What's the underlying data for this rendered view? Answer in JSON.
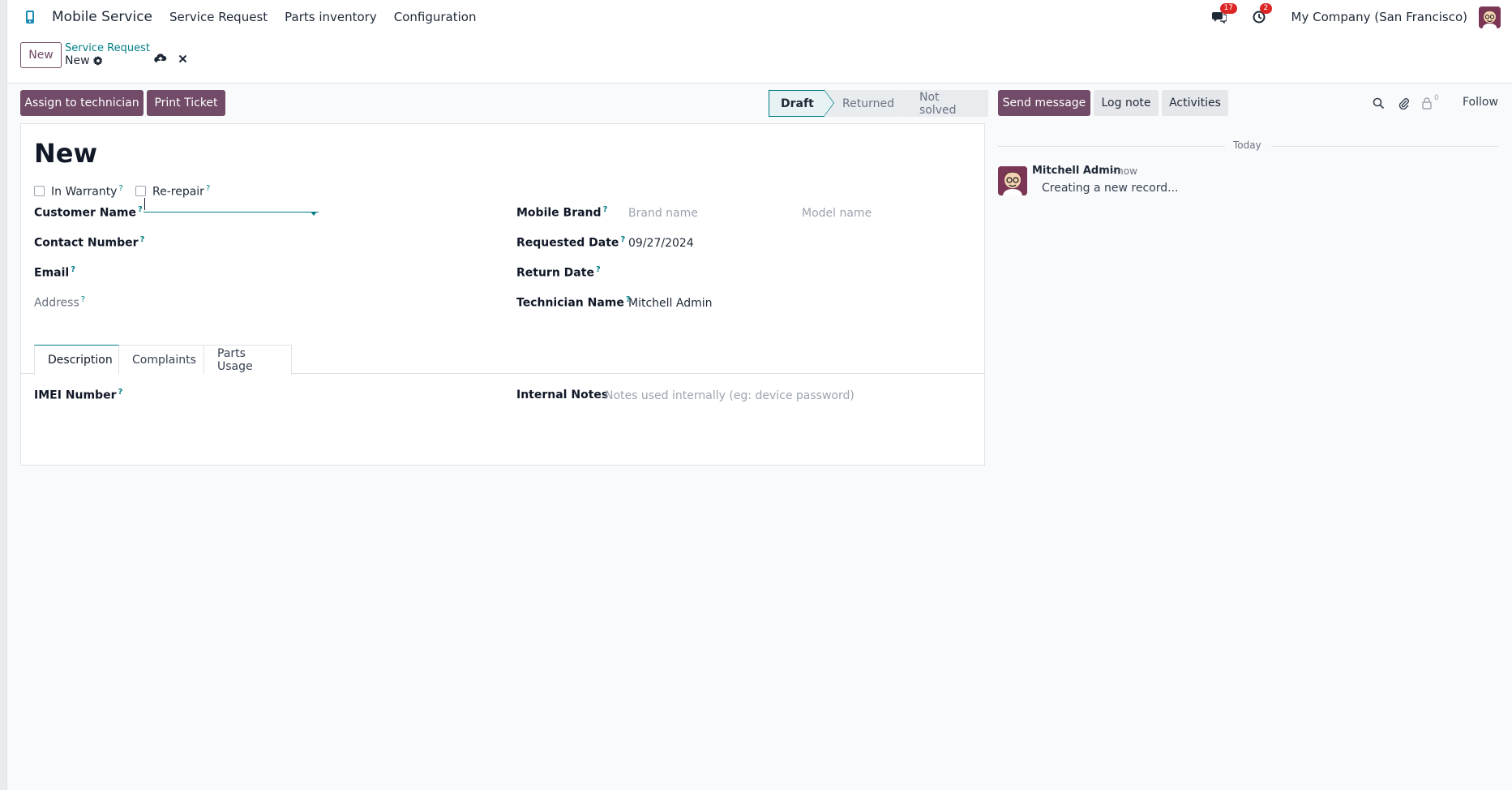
{
  "navbar": {
    "app_name": "Mobile Service",
    "menu": [
      "Service Request",
      "Parts inventory",
      "Configuration"
    ],
    "messages_count": "17",
    "activities_count": "2",
    "company": "My Company (San Francisco)"
  },
  "control_panel": {
    "new_button": "New",
    "breadcrumb_parent": "Service Request",
    "breadcrumb_current": "New"
  },
  "actions": {
    "assign_button": "Assign to technician",
    "print_button": "Print Ticket"
  },
  "statusbar": {
    "stages": [
      "Draft",
      "Returned",
      "Not solved"
    ],
    "active": "Draft"
  },
  "form": {
    "title": "New",
    "in_warranty_label": "In Warranty",
    "re_repair_label": "Re-repair",
    "help_mark": "?",
    "customer_name_label": "Customer Name",
    "contact_number_label": "Contact Number",
    "email_label": "Email",
    "address_placeholder": "Address",
    "mobile_brand_label": "Mobile Brand",
    "brand_placeholder": "Brand name",
    "model_placeholder": "Model name",
    "requested_date_label": "Requested Date",
    "requested_date_value": "09/27/2024",
    "return_date_label": "Return Date",
    "technician_label": "Technician Name",
    "technician_value": "Mitchell Admin",
    "tabs": [
      "Description",
      "Complaints",
      "Parts Usage"
    ],
    "imei_label": "IMEI Number",
    "internal_notes_label": "Internal Notes",
    "internal_notes_placeholder": "Notes used internally (eg: device password)"
  },
  "chatter": {
    "send_message": "Send message",
    "log_note": "Log note",
    "activities": "Activities",
    "followers_count": "0",
    "follow": "Follow",
    "date_separator": "Today",
    "message_author": "Mitchell Admin",
    "message_time": "- now",
    "message_body": "Creating a new record..."
  },
  "colors": {
    "primary": "#714B67",
    "accent": "#017e84",
    "badge": "#dc2626"
  }
}
